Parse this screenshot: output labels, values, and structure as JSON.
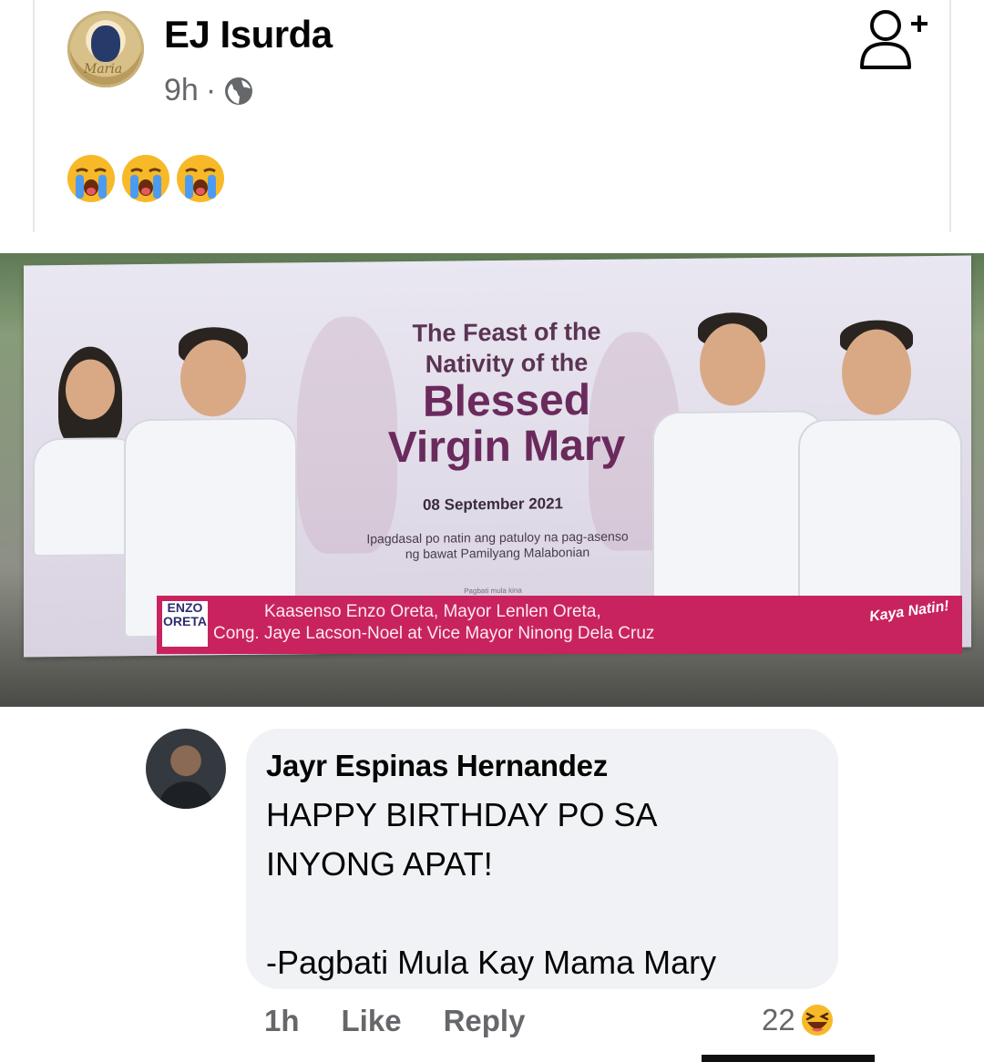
{
  "post": {
    "author": "EJ Isurda",
    "time": "9h",
    "separator": "·",
    "avatar_script": "Maria",
    "emojis": [
      "crying-face",
      "crying-face",
      "crying-face"
    ],
    "privacy_icon": "globe-icon",
    "add_friend_icon": "add-friend-icon"
  },
  "image": {
    "title_line1": "The Feast of the",
    "title_line2": "Nativity of the",
    "title_line3": "Blessed",
    "title_line4": "Virgin Mary",
    "date": "08 September 2021",
    "tagline_line1": "Ipagdasal po natin ang patuloy na pag-asenso",
    "tagline_line2": "ng bawat Pamilyang Malabonian",
    "from_label": "Pagbati mula kina",
    "strip_line1": "Kaasenso Enzo Oreta, Mayor Lenlen Oreta,",
    "strip_line2": "Cong. Jaye Lacson-Noel at Vice Mayor Ninong Dela Cruz",
    "logo_line1": "ENZO",
    "logo_line2": "ORETA",
    "slogan": "Kaya Natin!"
  },
  "comment": {
    "author": "Jayr Espinas Hernandez",
    "text": "HAPPY BIRTHDAY PO SA\nINYONG APAT!\n\n-Pagbati Mula Kay Mama Mary",
    "time": "1h",
    "like_label": "Like",
    "reply_label": "Reply",
    "reaction_count": "22",
    "reaction_icon": "haha-icon"
  },
  "colors": {
    "text_primary": "#050505",
    "text_secondary": "#65676b",
    "bubble_bg": "#f0f2f5",
    "banner_strip": "#c8235f"
  }
}
